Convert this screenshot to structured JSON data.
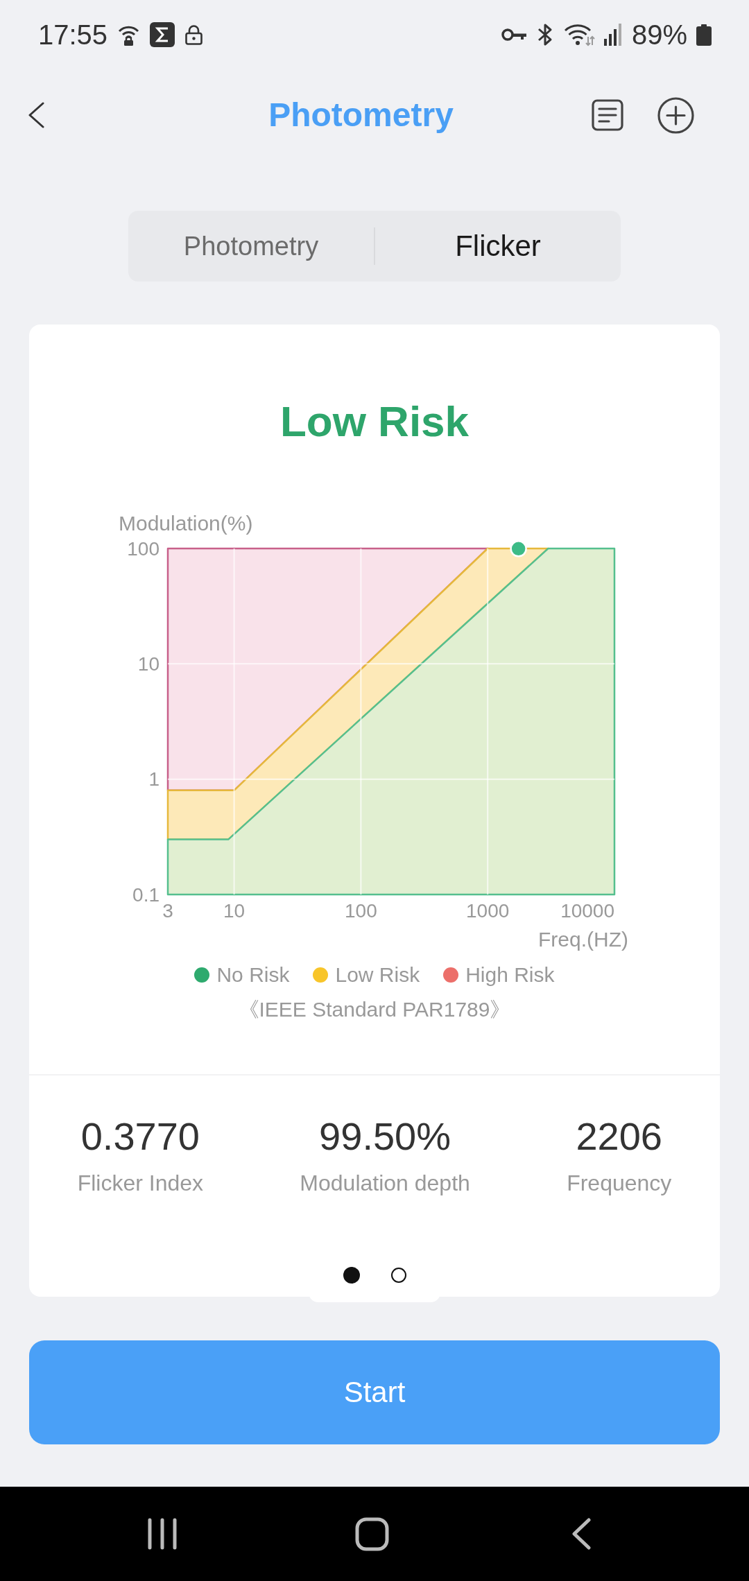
{
  "status_bar": {
    "time": "17:55",
    "battery": "89%"
  },
  "header": {
    "title": "Photometry"
  },
  "tabs": [
    {
      "label": "Photometry",
      "selected": false
    },
    {
      "label": "Flicker",
      "selected": true
    }
  ],
  "card": {
    "risk": "Low Risk",
    "chart": {
      "y_title": "Modulation(%)",
      "y_ticks": [
        "100",
        "10",
        "1",
        "0.1"
      ],
      "x_ticks": [
        "3",
        "10",
        "100",
        "1000",
        "10000"
      ],
      "x_title": "Freq.(HZ)",
      "legend": [
        {
          "label": "No Risk",
          "color": "#2eaa6e"
        },
        {
          "label": "Low Risk",
          "color": "#f8c52a"
        },
        {
          "label": "High Risk",
          "color": "#ec6f6a"
        }
      ]
    },
    "standard": "《IEEE Standard PAR1789》",
    "stats": [
      {
        "value": "0.3770",
        "label": "Flicker Index"
      },
      {
        "value": "99.50%",
        "label": "Modulation depth"
      },
      {
        "value": "2206",
        "label": "Frequency"
      }
    ],
    "pages": [
      {
        "selected": true
      },
      {
        "selected": false
      }
    ]
  },
  "start_button": {
    "label": "Start"
  }
}
